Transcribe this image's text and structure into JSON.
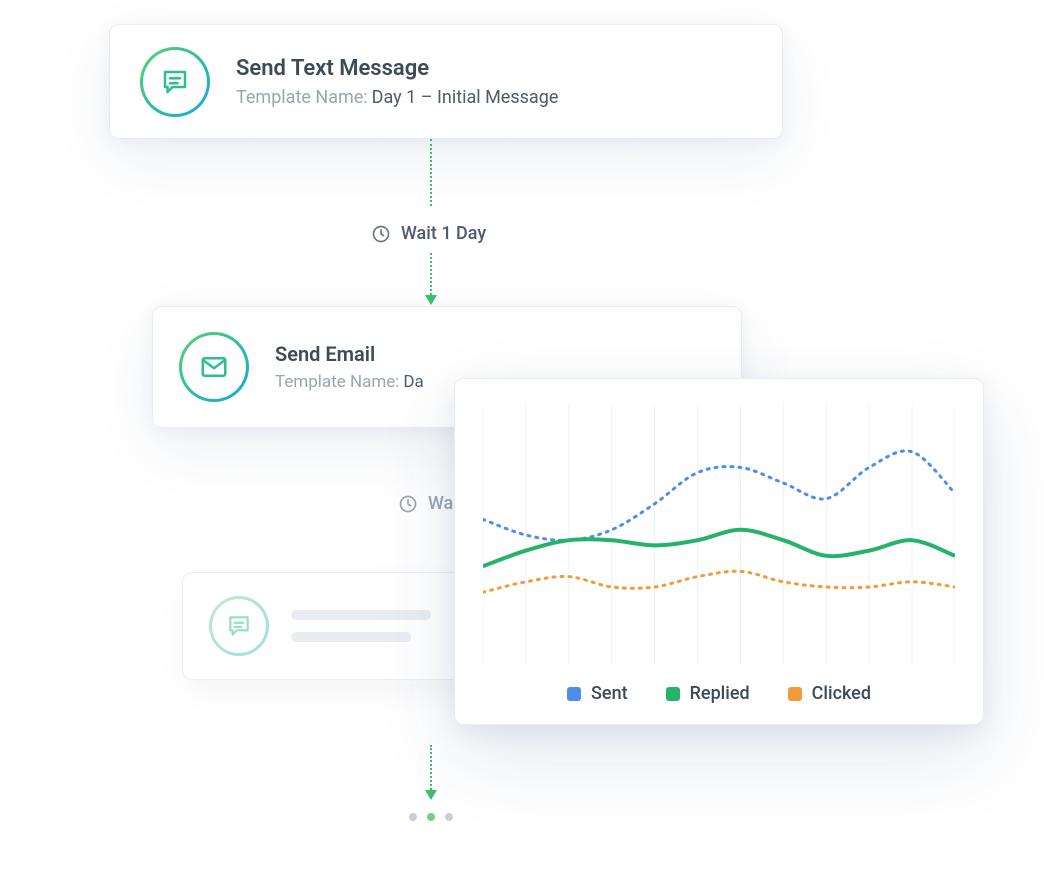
{
  "step1": {
    "title": "Send Text Message",
    "template_label": "Template Name:",
    "template_value": "Day 1 – Initial Message",
    "icon": "message-icon"
  },
  "wait1": {
    "label": "Wait 1 Day",
    "icon": "clock-icon"
  },
  "step2": {
    "title": "Send Email",
    "template_label": "Template Name:",
    "template_value_partial": "Da",
    "icon": "email-icon"
  },
  "wait2": {
    "label_partial": "Wa",
    "icon": "clock-icon"
  },
  "step3": {
    "icon": "message-icon"
  },
  "chart_data": {
    "type": "line",
    "xlabel": "",
    "ylabel": "",
    "categories": [
      0,
      1,
      2,
      3,
      4,
      5,
      6,
      7,
      8,
      9,
      10,
      11
    ],
    "series": [
      {
        "name": "Sent",
        "color": "#4C8EEB",
        "style": "dotted",
        "values": [
          56,
          50,
          48,
          52,
          62,
          74,
          76,
          70,
          64,
          76,
          82,
          66
        ]
      },
      {
        "name": "Replied",
        "color": "#25B26A",
        "style": "solid",
        "values": [
          38,
          44,
          48,
          48,
          46,
          48,
          52,
          48,
          42,
          44,
          48,
          42
        ]
      },
      {
        "name": "Clicked",
        "color": "#F39B3B",
        "style": "dotted",
        "values": [
          28,
          32,
          34,
          30,
          30,
          34,
          36,
          32,
          30,
          30,
          32,
          30
        ]
      }
    ],
    "ylim": [
      0,
      100
    ],
    "gridlines": 12
  },
  "legend": {
    "items": [
      {
        "label": "Sent",
        "color": "#4C8EEB"
      },
      {
        "label": "Replied",
        "color": "#25B26A"
      },
      {
        "label": "Clicked",
        "color": "#F39B3B"
      }
    ]
  }
}
